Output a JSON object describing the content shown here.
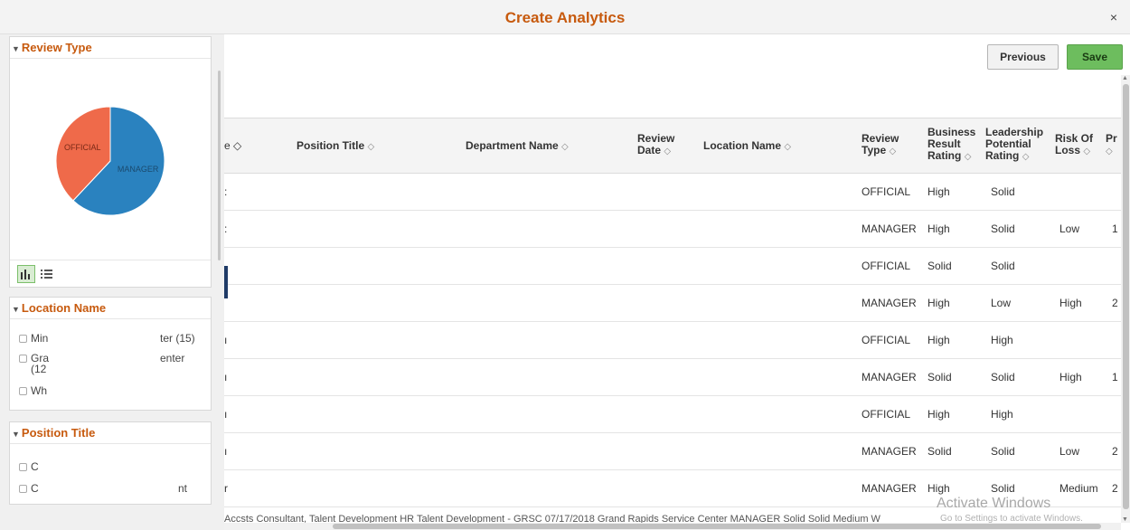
{
  "modal": {
    "title": "Create Analytics",
    "close_glyph": "×"
  },
  "toolbar": {
    "previous_label": "Previous",
    "save_label": "Save"
  },
  "facets": {
    "review_type": {
      "title": "Review Type",
      "chart_data": {
        "type": "pie",
        "categories": [
          "OFFICIAL",
          "MANAGER"
        ],
        "values": [
          38,
          62
        ],
        "colors": [
          "#ef6a4a",
          "#2a82bf"
        ]
      }
    },
    "location_name": {
      "title": "Location Name",
      "items": [
        "Min",
        "ter (15)",
        "Gra",
        "enter",
        "(12",
        "Wh"
      ]
    },
    "position_title": {
      "title": "Position Title",
      "items": [
        "C",
        "C",
        "nt"
      ]
    }
  },
  "grid": {
    "headers": {
      "col0": "e ◇",
      "position_title": "Position Title",
      "department_name": "Department Name",
      "review_date_1": "Review",
      "review_date_2": "Date",
      "location_name": "Location Name",
      "review_type_1": "Review",
      "review_type_2": "Type",
      "business_1": "Business",
      "business_2": "Result",
      "business_3": "Rating",
      "leadership_1": "Leadership",
      "leadership_2": "Potential",
      "leadership_3": "Rating",
      "risk_1": "Risk Of",
      "risk_2": "Loss",
      "pr": "Pr",
      "sort_glyph": "◇"
    },
    "rows": [
      {
        "lead": ":",
        "type": "OFFICIAL",
        "business": "High",
        "leadership": "Solid",
        "risk": "",
        "pr": ""
      },
      {
        "lead": ":",
        "type": "MANAGER",
        "business": "High",
        "leadership": "Solid",
        "risk": "Low",
        "pr": "1"
      },
      {
        "lead": "",
        "type": "OFFICIAL",
        "business": "Solid",
        "leadership": "Solid",
        "risk": "",
        "pr": ""
      },
      {
        "lead": "",
        "type": "MANAGER",
        "business": "High",
        "leadership": "Low",
        "risk": "High",
        "pr": "2"
      },
      {
        "lead": "ı",
        "type": "OFFICIAL",
        "business": "High",
        "leadership": "High",
        "risk": "",
        "pr": ""
      },
      {
        "lead": "ı",
        "type": "MANAGER",
        "business": "Solid",
        "leadership": "Solid",
        "risk": "High",
        "pr": "1"
      },
      {
        "lead": "ı",
        "type": "OFFICIAL",
        "business": "High",
        "leadership": "High",
        "risk": "",
        "pr": ""
      },
      {
        "lead": "ı",
        "type": "MANAGER",
        "business": "Solid",
        "leadership": "Solid",
        "risk": "Low",
        "pr": "2"
      },
      {
        "lead": "r",
        "type": "MANAGER",
        "business": "High",
        "leadership": "Solid",
        "risk": "Medium",
        "pr": "2"
      }
    ],
    "partial_last_row": "Accsts    Consultant, Talent Development   HR Talent Development - GRSC   07/17/2018   Grand Rapids Service Center   MANAGER  Solid    Solid    Medium  W"
  },
  "watermark": {
    "line1": "Activate Windows",
    "line2": "Go to Settings to activate Windows."
  }
}
